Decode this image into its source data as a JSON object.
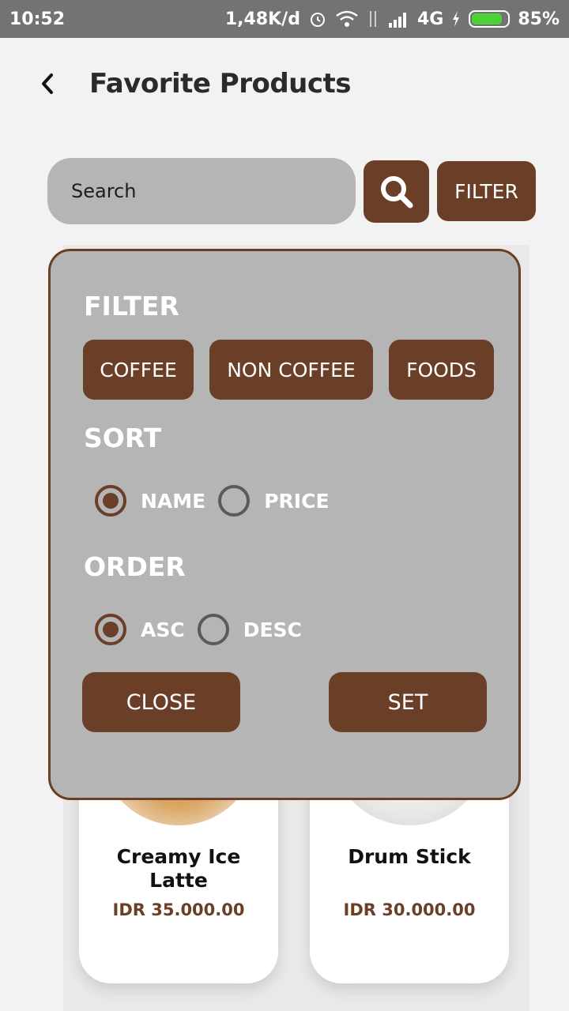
{
  "status_bar": {
    "time": "10:52",
    "speed": "1,48K/d",
    "network": "4G",
    "battery": "85%",
    "battery_level": 0.85
  },
  "header": {
    "title": "Favorite Products"
  },
  "search": {
    "placeholder": "Search",
    "filter_label": "FILTER"
  },
  "filter_panel": {
    "filter_title": "FILTER",
    "categories": [
      "COFFEE",
      "NON COFFEE",
      "FOODS"
    ],
    "sort_title": "SORT",
    "sort_options": [
      "NAME",
      "PRICE"
    ],
    "sort_selected": "NAME",
    "order_title": "ORDER",
    "order_options": [
      "ASC",
      "DESC"
    ],
    "order_selected": "ASC",
    "close_label": "CLOSE",
    "set_label": "SET"
  },
  "products": [
    {
      "name": "Creamy Ice Latte",
      "price": "IDR 35.000.00"
    },
    {
      "name": "Drum Stick",
      "price": "IDR 30.000.00"
    }
  ],
  "colors": {
    "brand": "#6b3f27",
    "panel": "#b5b5b5",
    "status_bar": "#737373",
    "background": "#f2f2f2"
  }
}
